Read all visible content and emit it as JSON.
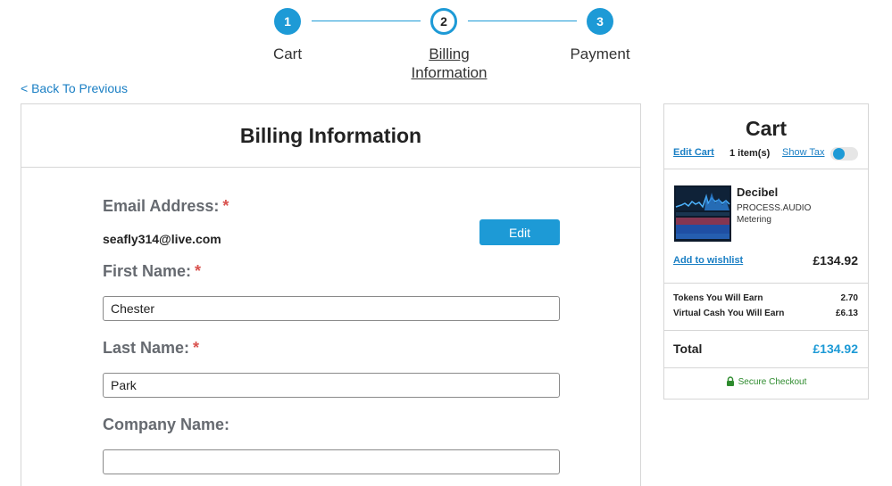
{
  "stepper": {
    "steps": [
      {
        "number": "1",
        "label": "Cart"
      },
      {
        "number": "2",
        "label_line1": "Billing",
        "label_line2": "Information"
      },
      {
        "number": "3",
        "label": "Payment"
      }
    ],
    "accent": "#1d9ad6"
  },
  "nav": {
    "back_label": "< Back To Previous"
  },
  "billing": {
    "title": "Billing Information",
    "required_marker": "*",
    "email": {
      "label": "Email Address:",
      "value": "seafly314@live.com",
      "edit_label": "Edit"
    },
    "first_name": {
      "label": "First Name:",
      "value": "Chester"
    },
    "last_name": {
      "label": "Last Name:",
      "value": "Park"
    },
    "company": {
      "label": "Company Name:",
      "value": ""
    }
  },
  "cart": {
    "title": "Cart",
    "edit_label": "Edit Cart",
    "item_count": "1 item(s)",
    "show_tax_label": "Show Tax",
    "show_tax_on": true,
    "product": {
      "name": "Decibel",
      "vendor": "PROCESS.AUDIO",
      "category": "Metering",
      "wishlist_label": "Add to wishlist",
      "price": "£134.92"
    },
    "tokens_label": "Tokens You Will Earn",
    "tokens_value": "2.70",
    "cash_label": "Virtual Cash You Will Earn",
    "cash_value": "£6.13",
    "total_label": "Total",
    "total_value": "£134.92",
    "secure_label": "Secure Checkout",
    "secure_color": "#2e8b2e"
  }
}
